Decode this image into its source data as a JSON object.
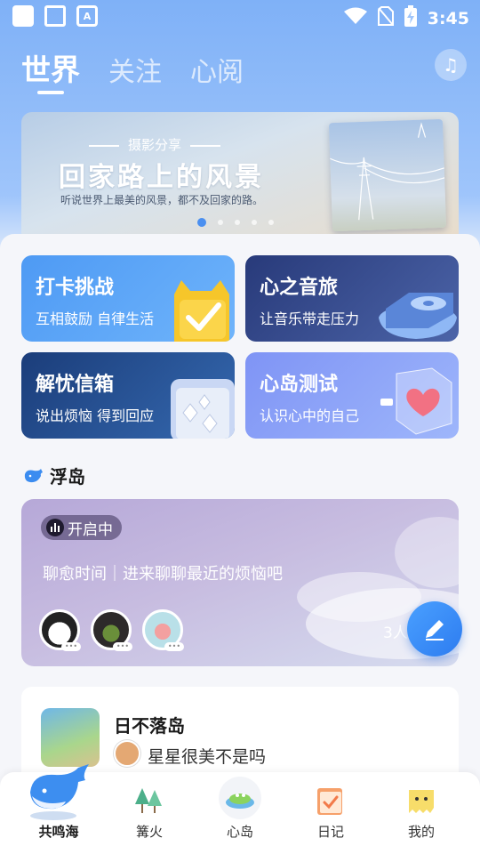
{
  "status_bar": {
    "time": "3:45"
  },
  "nav": {
    "tabs": [
      "世界",
      "关注",
      "心阅"
    ],
    "active_tab": 0
  },
  "banner": {
    "subtitle": "摄影分享",
    "title": "回家路上的风景",
    "description": "听说世界上最美的风景，都不及回家的路。",
    "page_count": 5,
    "active_page": 0
  },
  "cards": [
    {
      "title": "打卡挑战",
      "subtitle": "互相鼓励 自律生活"
    },
    {
      "title": "心之音旅",
      "subtitle": "让音乐带走压力"
    },
    {
      "title": "解忧信箱",
      "subtitle": "说出烦恼 得到回应"
    },
    {
      "title": "心岛测试",
      "subtitle": "认识心中的自己"
    }
  ],
  "section": {
    "title": "浮岛"
  },
  "island": {
    "status": "开启中",
    "topic": "聊愈时间｜进来聊聊最近的烦恼吧",
    "member_count": "3人"
  },
  "post": {
    "title": "日不落岛",
    "message": "星星很美不是吗"
  },
  "bottom_nav": {
    "items": [
      {
        "label": "共鸣海",
        "icon": "whale-icon"
      },
      {
        "label": "篝火",
        "icon": "campfire-icon"
      },
      {
        "label": "心岛",
        "icon": "island-icon"
      },
      {
        "label": "日记",
        "icon": "diary-icon"
      },
      {
        "label": "我的",
        "icon": "profile-icon"
      }
    ],
    "active_index": 0
  },
  "colors": {
    "accent": "#4a8ff0",
    "header_bg": "#7fb1f7",
    "card_checkin": "#4e9af4",
    "card_music": "#283a7a",
    "card_mailbox": "#1b3d7a",
    "card_test": "#7f94f5"
  }
}
